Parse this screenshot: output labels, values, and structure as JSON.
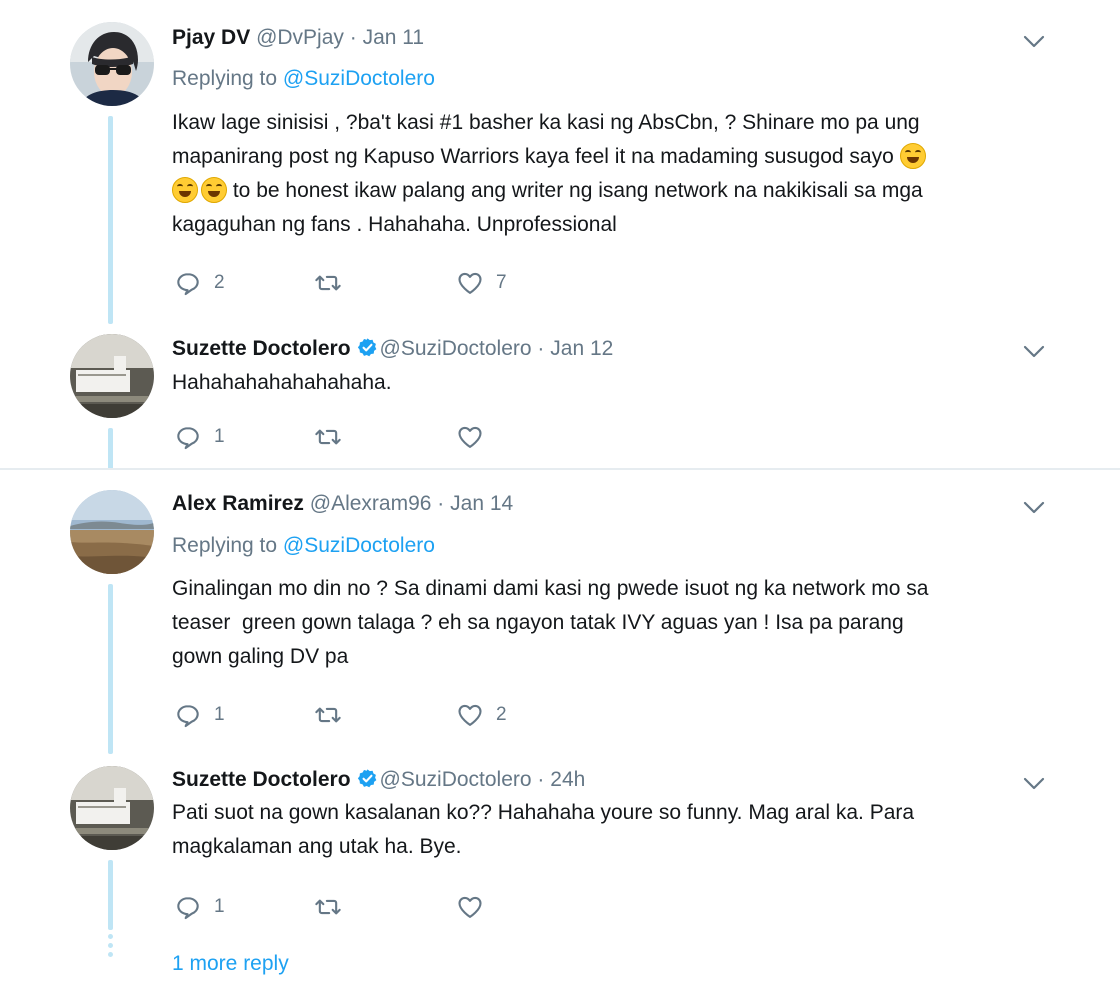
{
  "tweets": [
    {
      "name": "Pjay DV",
      "handle": "@DvPjay",
      "dot": "·",
      "time": "Jan 11",
      "replying_prefix": "Replying to ",
      "replying_to": "@SuziDoctolero",
      "lines": [
        "Ikaw lage sinisisi , ?ba't kasi #1 basher ka kasi ng AbsCbn, ? Shinare mo pa ung",
        "mapanirang post ng Kapuso Warriors kaya feel it na madaming susugod sayo",
        "to be honest ikaw palang ang writer ng isang network na nakikisali sa mga",
        "kagaguhan ng fans . Hahahaha. Unprofessional"
      ],
      "replies": "2",
      "retweets": "",
      "likes": "7"
    },
    {
      "name": "Suzette Doctolero",
      "handle": "@SuziDoctolero",
      "dot": "·",
      "time": "Jan 12",
      "lines": [
        "Hahahahahahahahaha."
      ],
      "replies": "1",
      "retweets": "",
      "likes": ""
    },
    {
      "name": "Alex Ramirez",
      "handle": "@Alexram96",
      "dot": "·",
      "time": "Jan 14",
      "replying_prefix": "Replying to ",
      "replying_to": "@SuziDoctolero",
      "lines": [
        "Ginalingan mo din no ? Sa dinami dami kasi ng pwede isuot ng ka network mo sa",
        "teaser  green gown talaga ? eh sa ngayon tatak IVY aguas yan ! Isa pa parang",
        "gown galing DV pa"
      ],
      "replies": "1",
      "retweets": "",
      "likes": "2"
    },
    {
      "name": "Suzette Doctolero",
      "handle": "@SuziDoctolero",
      "dot": "·",
      "time": "24h",
      "lines": [
        "Pati suot na gown kasalanan ko?? Hahahaha youre so funny. Mag aral ka. Para",
        "magkalaman ang utak ha. Bye."
      ],
      "replies": "1",
      "retweets": "",
      "likes": ""
    }
  ],
  "more_reply": "1 more reply",
  "icons": {
    "reply": "reply-icon",
    "retweet": "retweet-icon",
    "like": "heart-icon",
    "verified": "verified-badge-icon",
    "menu": "chevron-down-icon",
    "emoji": "face-with-tears-of-joy-emoji"
  },
  "colors": {
    "link": "#1da1f2",
    "muted": "#657786",
    "thread_line": "#bfe5f5",
    "verified": "#1da1f2"
  }
}
